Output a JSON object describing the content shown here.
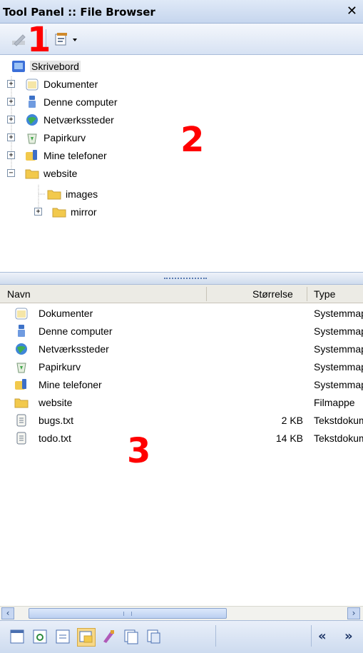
{
  "window": {
    "title": "Tool Panel :: File Browser",
    "close_glyph": "✕"
  },
  "callouts": {
    "one": "1",
    "two": "2",
    "three": "3"
  },
  "toolbar": {
    "buttons": [
      {
        "icon": "edit-icon",
        "disabled": true
      },
      {
        "icon": "properties-dropdown-icon"
      }
    ]
  },
  "tree": {
    "items": [
      {
        "label": "Skrivebord",
        "icon": "desktop-icon",
        "selected": true
      },
      {
        "label": "Dokumenter",
        "icon": "folder-icon",
        "expander": "+"
      },
      {
        "label": "Denne computer",
        "icon": "computer-icon",
        "expander": "+"
      },
      {
        "label": "Netværkssteder",
        "icon": "network-icon",
        "expander": "+"
      },
      {
        "label": "Papirkurv",
        "icon": "recycle-bin-icon",
        "expander": "+"
      },
      {
        "label": "Mine telefoner",
        "icon": "phone-folder-icon",
        "expander": "+"
      },
      {
        "label": "website",
        "icon": "folder-icon",
        "expander": "−"
      },
      {
        "label": "images",
        "icon": "folder-icon"
      },
      {
        "label": "mirror",
        "icon": "folder-icon",
        "expander": "+"
      }
    ]
  },
  "list": {
    "columns": {
      "name": "Navn",
      "size": "Størrelse",
      "type": "Type"
    },
    "rows": [
      {
        "name": "Dokumenter",
        "size": "",
        "type": "Systemmappe",
        "icon": "folder-icon"
      },
      {
        "name": "Denne computer",
        "size": "",
        "type": "Systemmappe",
        "icon": "computer-icon"
      },
      {
        "name": "Netværkssteder",
        "size": "",
        "type": "Systemmappe",
        "icon": "network-icon"
      },
      {
        "name": "Papirkurv",
        "size": "",
        "type": "Systemmappe",
        "icon": "recycle-bin-icon"
      },
      {
        "name": "Mine telefoner",
        "size": "",
        "type": "Systemmappe",
        "icon": "phone-folder-icon"
      },
      {
        "name": "website",
        "size": "",
        "type": "Filmappe",
        "icon": "folder-icon"
      },
      {
        "name": "bugs.txt",
        "size": "2 KB",
        "type": "Tekstdokument",
        "icon": "text-file-icon"
      },
      {
        "name": "todo.txt",
        "size": "14 KB",
        "type": "Tekstdokument",
        "icon": "text-file-icon"
      }
    ]
  },
  "scrollbar": {
    "left_glyph": "‹",
    "right_glyph": "›"
  },
  "bottombar": {
    "prev_label": "«",
    "next_label": "»"
  },
  "colors": {
    "accent": "#3a5fa8",
    "callout": "#ff0000",
    "folder": "#f2c94c"
  }
}
